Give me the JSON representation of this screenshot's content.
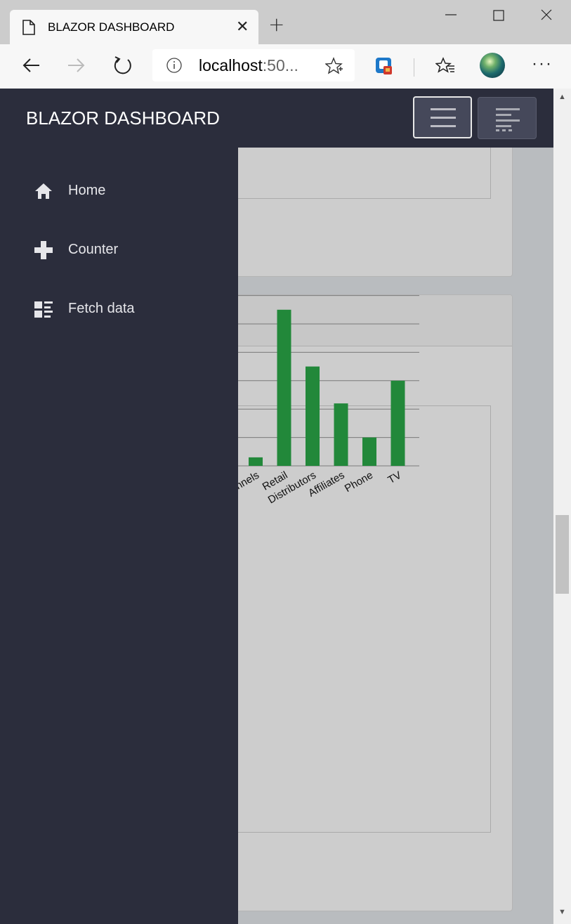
{
  "browser": {
    "tab_title": "BLAZOR DASHBOARD",
    "url_host": "localhost",
    "url_port": ":50..."
  },
  "app": {
    "brand": "BLAZOR DASHBOARD"
  },
  "sidebar": {
    "items": [
      {
        "label": "Home",
        "icon": "home-icon"
      },
      {
        "label": "Counter",
        "icon": "plus-icon"
      },
      {
        "label": "Fetch data",
        "icon": "list-icon"
      }
    ]
  },
  "colors": {
    "sidebar_bg": "#2b2d3c",
    "bar_color": "#22883a",
    "content_bg": "#cdcdcd"
  },
  "chart_data": {
    "type": "bar",
    "categories": [
      "nnels",
      "Retail",
      "Distributors",
      "Affiliates",
      "Phone",
      "TV"
    ],
    "values": [
      0.3,
      5.5,
      3.5,
      2.2,
      1.0,
      3.0
    ],
    "ylim": [
      0,
      10
    ],
    "grid": true,
    "bar_color": "#22883a"
  }
}
